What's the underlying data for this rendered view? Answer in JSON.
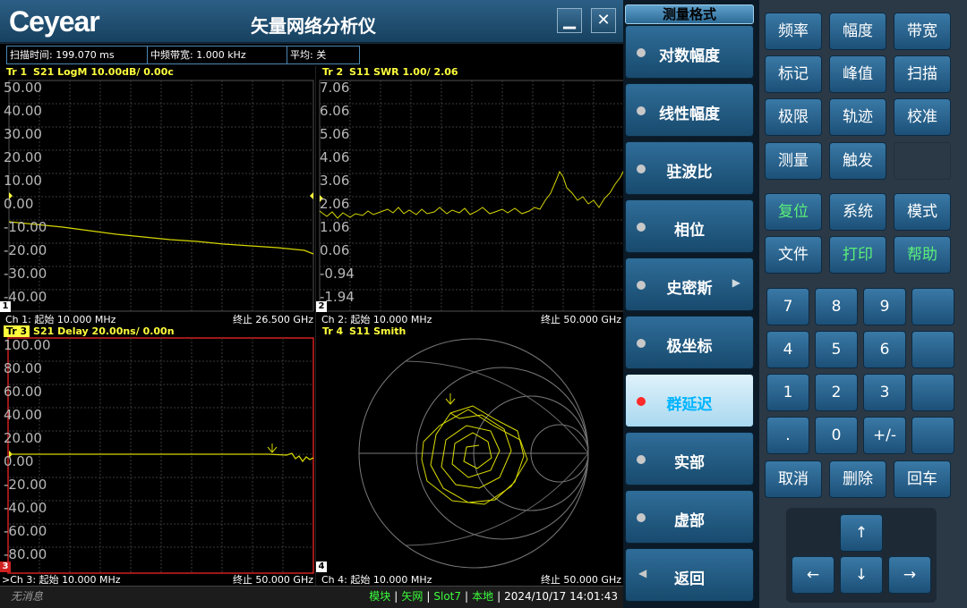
{
  "app": {
    "logo": "Ceyear",
    "title": "矢量网络分析仪",
    "minimize_glyph": "▁",
    "close_glyph": "✕"
  },
  "status": {
    "sweep_time": "扫描时间:  199.070 ms",
    "if_bw": "中频带宽:  1.000 kHz",
    "average": "平均:  关"
  },
  "traces": {
    "tr1": {
      "tag": "Tr 1",
      "desc": "S21 LogM 10.00dB/ 0.00c",
      "ticks": [
        "50.00",
        "40.00",
        "30.00",
        "20.00",
        "10.00",
        "0.00",
        "-10.00",
        "-20.00",
        "-30.00",
        "-40.00"
      ],
      "start": "Ch 1: 起始 10.000 MHz",
      "stop": "终止 26.500 GHz",
      "num": "1"
    },
    "tr2": {
      "tag": "Tr 2",
      "desc": "S11 SWR 1.00/ 2.06",
      "ticks": [
        "7.06",
        "6.06",
        "5.06",
        "4.06",
        "3.06",
        "2.06",
        "1.06",
        "0.06",
        "-0.94",
        "-1.94"
      ],
      "start": "Ch 2: 起始 10.000 MHz",
      "stop": "终止 50.000 GHz",
      "num": "2"
    },
    "tr3": {
      "tag": "Tr 3",
      "desc": "S21 Delay 20.00ns/ 0.00n",
      "ticks": [
        "100.00",
        "80.00",
        "60.00",
        "40.00",
        "20.00",
        "0.00",
        "-20.00",
        "-40.00",
        "-60.00",
        "-80.00"
      ],
      "start": ">Ch 3: 起始 10.000 MHz",
      "stop": "终止 50.000 GHz",
      "num": "3"
    },
    "tr4": {
      "tag": "Tr 4",
      "desc": "S11 Smith",
      "start": "Ch 4: 起始 10.000 MHz",
      "stop": "终止 50.000 GHz",
      "num": "4"
    }
  },
  "bottom": {
    "message": "无消息",
    "module": "模块",
    "vna": "矢网",
    "slot": "Slot7",
    "local": "本地",
    "datetime": "2024/10/17 14:01:43"
  },
  "menu": {
    "title": "测量格式",
    "items": [
      {
        "label": "对数幅度"
      },
      {
        "label": "线性幅度"
      },
      {
        "label": "驻波比"
      },
      {
        "label": "相位"
      },
      {
        "label": "史密斯",
        "arrow": "▶"
      },
      {
        "label": "极坐标"
      },
      {
        "label": "群延迟"
      },
      {
        "label": "实部"
      },
      {
        "label": "虚部"
      },
      {
        "label": "返回",
        "arrow": "◀"
      }
    ]
  },
  "keys": {
    "row1": [
      "频率",
      "幅度",
      "带宽"
    ],
    "row2": [
      "标记",
      "峰值",
      "扫描"
    ],
    "row3": [
      "极限",
      "轨迹",
      "校准"
    ],
    "row4": [
      "测量",
      "触发"
    ],
    "row5": [
      "复位",
      "系统",
      "模式"
    ],
    "row6": [
      "文件",
      "打印",
      "帮助"
    ],
    "num1": [
      "7",
      "8",
      "9"
    ],
    "num2": [
      "4",
      "5",
      "6"
    ],
    "num3": [
      "1",
      "2",
      "3"
    ],
    "num4": [
      ".",
      "0",
      "+/-"
    ],
    "row7": [
      "取消",
      "删除",
      "回车"
    ],
    "nav": {
      "up": "↑",
      "left": "←",
      "down": "↓",
      "right": "→"
    }
  },
  "colors": {
    "trace": "#ffff3c",
    "active_softkey_text": "#00b4ff",
    "green_key_text": "#5cf07a"
  }
}
